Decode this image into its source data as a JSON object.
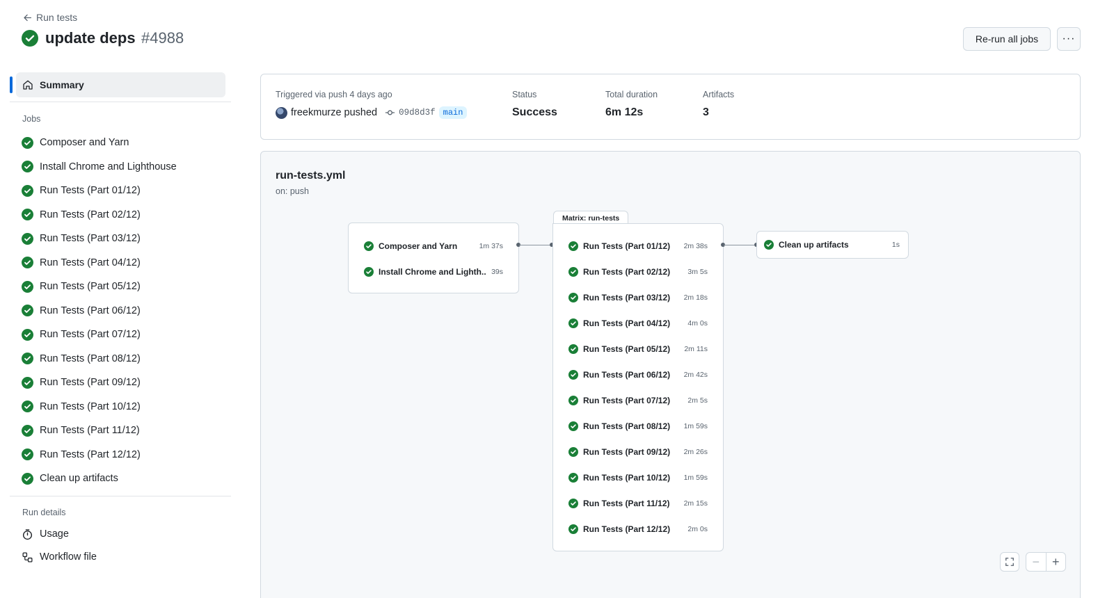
{
  "header": {
    "back_label": "Run tests",
    "title": "update deps",
    "run_number": "#4988",
    "rerun_label": "Re-run all jobs",
    "more_label": "···"
  },
  "sidebar": {
    "summary_label": "Summary",
    "jobs_heading": "Jobs",
    "jobs": [
      "Composer and Yarn",
      "Install Chrome and Lighthouse",
      "Run Tests (Part 01/12)",
      "Run Tests (Part 02/12)",
      "Run Tests (Part 03/12)",
      "Run Tests (Part 04/12)",
      "Run Tests (Part 05/12)",
      "Run Tests (Part 06/12)",
      "Run Tests (Part 07/12)",
      "Run Tests (Part 08/12)",
      "Run Tests (Part 09/12)",
      "Run Tests (Part 10/12)",
      "Run Tests (Part 11/12)",
      "Run Tests (Part 12/12)",
      "Clean up artifacts"
    ],
    "run_details_heading": "Run details",
    "usage_label": "Usage",
    "workflow_file_label": "Workflow file"
  },
  "info": {
    "trigger_label": "Triggered via push 4 days ago",
    "actor": "freekmurze pushed",
    "commit": "09d8d3f",
    "branch": "main",
    "status_label": "Status",
    "status_value": "Success",
    "duration_label": "Total duration",
    "duration_value": "6m 12s",
    "artifacts_label": "Artifacts",
    "artifacts_value": "3"
  },
  "graph": {
    "workflow_name": "run-tests.yml",
    "trigger": "on: push",
    "setup_jobs": [
      {
        "name": "Composer and Yarn",
        "duration": "1m 37s"
      },
      {
        "name": "Install Chrome and Lighth...",
        "duration": "39s"
      }
    ],
    "matrix_label": "Matrix: run-tests",
    "matrix_jobs": [
      {
        "name": "Run Tests (Part 01/12)",
        "duration": "2m 38s"
      },
      {
        "name": "Run Tests (Part 02/12)",
        "duration": "3m 5s"
      },
      {
        "name": "Run Tests (Part 03/12)",
        "duration": "2m 18s"
      },
      {
        "name": "Run Tests (Part 04/12)",
        "duration": "4m 0s"
      },
      {
        "name": "Run Tests (Part 05/12)",
        "duration": "2m 11s"
      },
      {
        "name": "Run Tests (Part 06/12)",
        "duration": "2m 42s"
      },
      {
        "name": "Run Tests (Part 07/12)",
        "duration": "2m 5s"
      },
      {
        "name": "Run Tests (Part 08/12)",
        "duration": "1m 59s"
      },
      {
        "name": "Run Tests (Part 09/12)",
        "duration": "2m 26s"
      },
      {
        "name": "Run Tests (Part 10/12)",
        "duration": "1m 59s"
      },
      {
        "name": "Run Tests (Part 11/12)",
        "duration": "2m 15s"
      },
      {
        "name": "Run Tests (Part 12/12)",
        "duration": "2m 0s"
      }
    ],
    "cleanup_job": {
      "name": "Clean up artifacts",
      "duration": "1s"
    }
  },
  "colors": {
    "success": "#1a7f37",
    "accent": "#0969da"
  },
  "icons": {
    "back": "arrow-left-icon",
    "status": "check-circle-icon",
    "summary": "home-icon",
    "usage": "stopwatch-icon",
    "workflow_file": "workflow-file-icon",
    "fullscreen": "fullscreen-icon",
    "zoom_out": "minus-icon",
    "zoom_in": "plus-icon"
  }
}
